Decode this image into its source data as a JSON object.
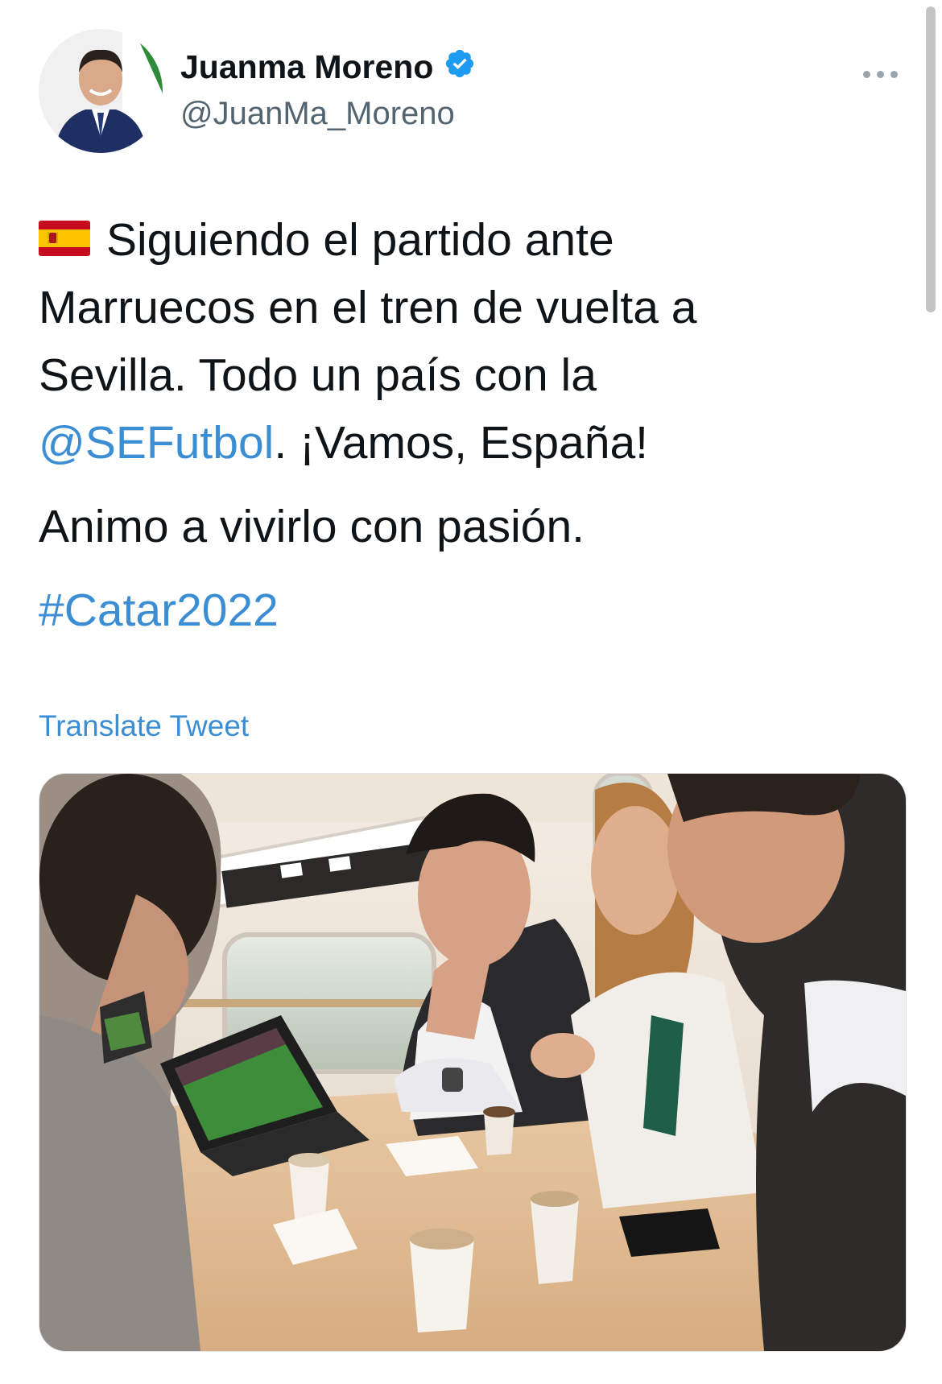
{
  "author": {
    "display_name": "Juanma Moreno",
    "handle": "@JuanMa_Moreno",
    "verified": true,
    "avatar_icon": "profile-photo-avatar"
  },
  "tweet": {
    "flag_icon": "spain-flag-emoji",
    "line1_text": "Siguiendo el partido ante",
    "line2_text": "Marruecos en el tren de vuelta a",
    "line3_text": "Sevilla. Todo un país con la",
    "mention": "@SEFutbol",
    "line4_rest": ". ¡Vamos, España!",
    "paragraph2": "Animo a vivirlo con pasión.",
    "hashtag": "#Catar2022"
  },
  "actions": {
    "translate_label": "Translate Tweet",
    "more_icon": "more-dots-icon"
  },
  "media": {
    "photo": "train-table-people-watching-tablet"
  },
  "colors": {
    "link": "#3b8ed4",
    "verified": "#1d9bf0",
    "handle": "#536471",
    "text": "#0f1419"
  }
}
